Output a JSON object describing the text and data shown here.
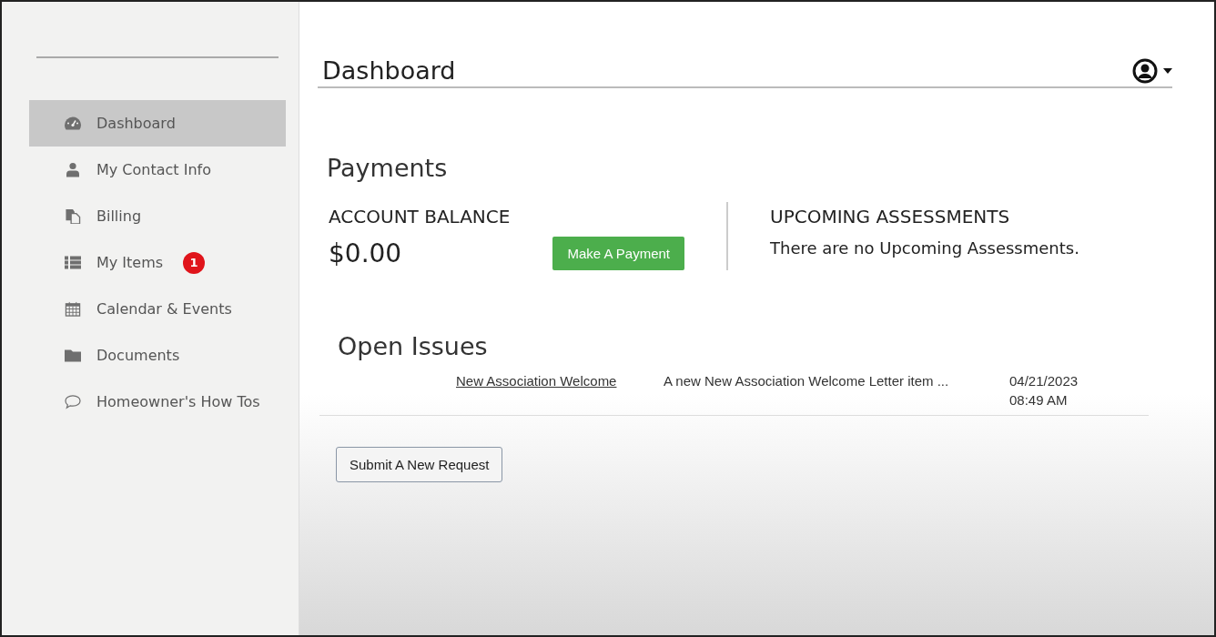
{
  "sidebar": {
    "items": [
      {
        "kind": "dashboard",
        "label": "Dashboard",
        "selected": true
      },
      {
        "kind": "user",
        "label": "My Contact Info",
        "selected": false
      },
      {
        "kind": "billing",
        "label": "Billing",
        "selected": false
      },
      {
        "kind": "list",
        "label": "My Items",
        "selected": false,
        "badge": "1"
      },
      {
        "kind": "calendar",
        "label": "Calendar & Events",
        "selected": false
      },
      {
        "kind": "folder",
        "label": "Documents",
        "selected": false
      },
      {
        "kind": "chat",
        "label": "Homeowner's How Tos",
        "selected": false
      }
    ]
  },
  "header": {
    "title": "Dashboard"
  },
  "payments": {
    "title": "Payments",
    "balance_label": "ACCOUNT BALANCE",
    "balance": "$0.00",
    "pay_button": "Make A Payment",
    "upcoming_label": "UPCOMING ASSESSMENTS",
    "upcoming_text": "There are no Upcoming Assessments."
  },
  "open_issues": {
    "title": "Open Issues",
    "rows": [
      {
        "title": "New Association Welcome",
        "summary": "A new New Association Welcome Letter item ...",
        "date": "04/21/2023",
        "time": "08:49 AM"
      }
    ],
    "submit_button": "Submit A New Request"
  }
}
